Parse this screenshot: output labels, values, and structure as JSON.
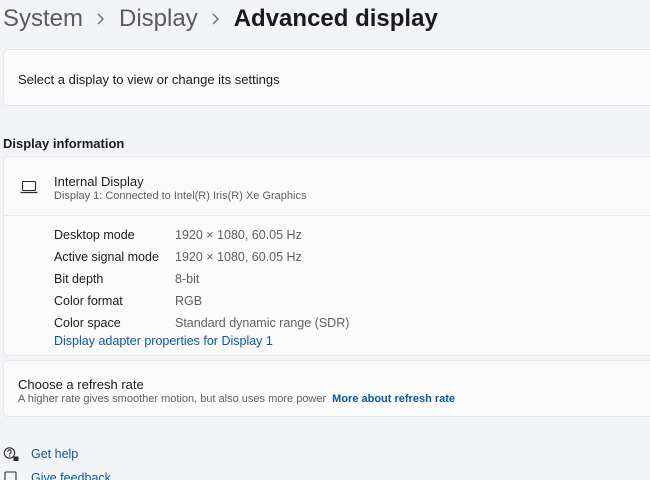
{
  "breadcrumb": {
    "system": "System",
    "display": "Display",
    "current": "Advanced display"
  },
  "select_display": {
    "text": "Select a display to view or change its settings"
  },
  "display_information": {
    "section_title": "Display information",
    "display_name": "Internal Display",
    "display_subtitle": "Display 1: Connected to Intel(R) Iris(R) Xe Graphics",
    "rows": [
      {
        "label": "Desktop mode",
        "value": "1920 × 1080, 60.05 Hz"
      },
      {
        "label": "Active signal mode",
        "value": "1920 × 1080, 60.05 Hz"
      },
      {
        "label": "Bit depth",
        "value": "8-bit"
      },
      {
        "label": "Color format",
        "value": "RGB"
      },
      {
        "label": "Color space",
        "value": "Standard dynamic range (SDR)"
      }
    ],
    "adapter_link": "Display adapter properties for Display 1"
  },
  "refresh_rate": {
    "title": "Choose a refresh rate",
    "description": "A higher rate gives smoother motion, but also uses more power",
    "link": "More about refresh rate"
  },
  "help": {
    "get_help": "Get help",
    "give_feedback": "Give feedback"
  },
  "colors": {
    "accent_link": "#0a57a5",
    "background": "#f3f4f7",
    "card": "#fbfbfb"
  },
  "icons": {
    "breadcrumb_separator": "chevron-right-icon",
    "display": "laptop-icon",
    "help": "help-icon",
    "feedback": "feedback-icon"
  }
}
